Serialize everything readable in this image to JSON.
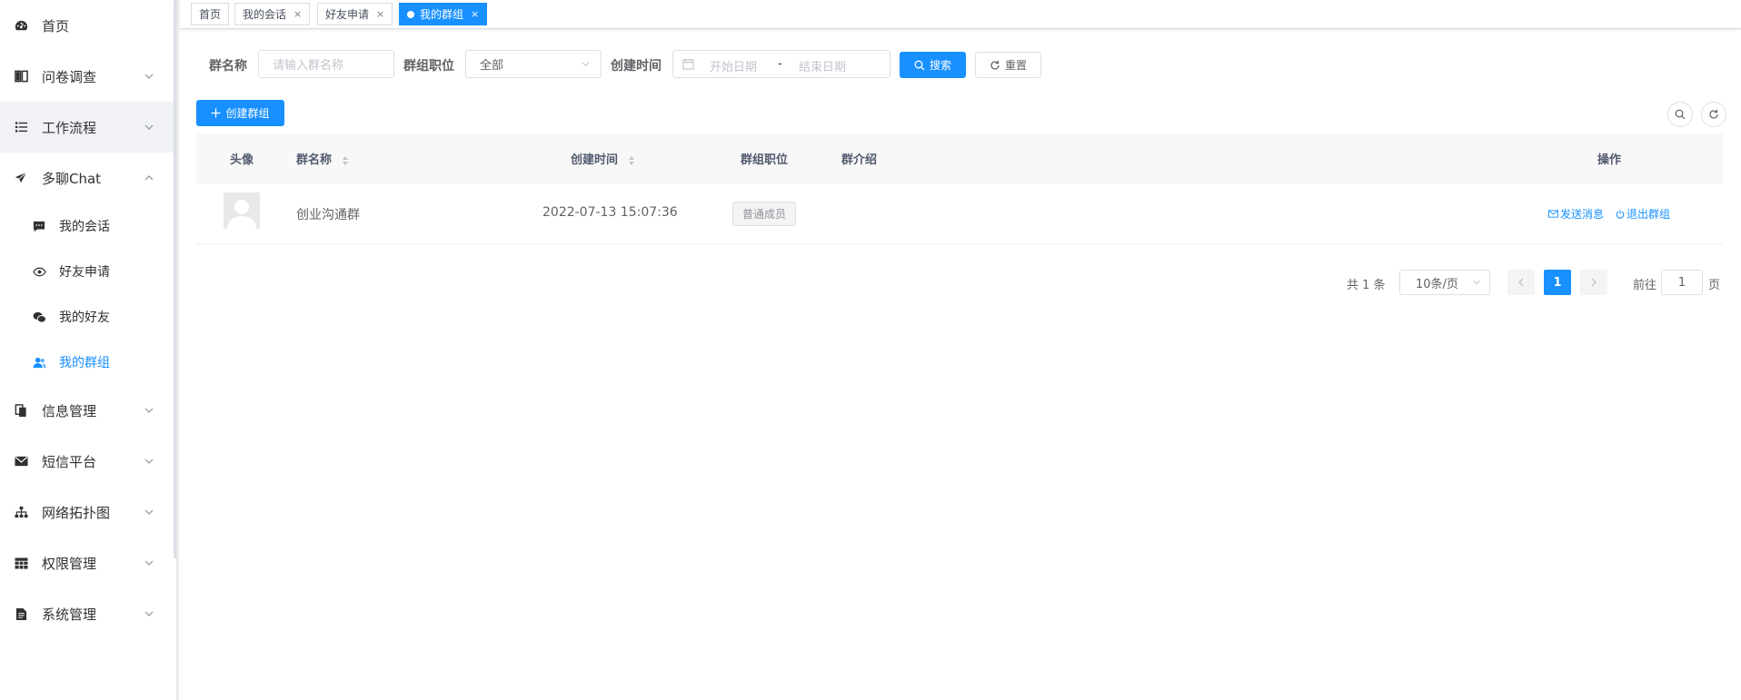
{
  "sidebar": {
    "items": [
      {
        "label": "首页",
        "icon": "dashboard-icon"
      },
      {
        "label": "问卷调查",
        "icon": "book-icon"
      },
      {
        "label": "工作流程",
        "icon": "list-icon"
      },
      {
        "label": "多聊Chat",
        "icon": "send-icon"
      },
      {
        "label": "信息管理",
        "icon": "documents-icon"
      },
      {
        "label": "短信平台",
        "icon": "mail-icon"
      },
      {
        "label": "网络拓扑图",
        "icon": "sitemap-icon"
      },
      {
        "label": "权限管理",
        "icon": "table-icon"
      },
      {
        "label": "系统管理",
        "icon": "file-text-icon"
      }
    ],
    "sub_items": [
      {
        "label": "我的会话",
        "icon": "message-icon"
      },
      {
        "label": "好友申请",
        "icon": "eye-icon"
      },
      {
        "label": "我的好友",
        "icon": "wechat-icon"
      },
      {
        "label": "我的群组",
        "icon": "users-icon"
      }
    ]
  },
  "tags": [
    {
      "label": "首页"
    },
    {
      "label": "我的会话",
      "close": "×"
    },
    {
      "label": "好友申请",
      "close": "×"
    },
    {
      "label": "我的群组",
      "close": "×"
    }
  ],
  "search": {
    "name_label": "群名称",
    "name_placeholder": "请输入群名称",
    "role_label": "群组职位",
    "role_value": "全部",
    "time_label": "创建时间",
    "start_placeholder": "开始日期",
    "range_sep": "-",
    "end_placeholder": "结束日期",
    "search_btn": "搜索",
    "reset_btn": "重置"
  },
  "toolbar": {
    "create_btn": "创建群组"
  },
  "table": {
    "headers": {
      "avatar": "头像",
      "name": "群名称",
      "created": "创建时间",
      "role": "群组职位",
      "intro": "群介绍",
      "actions": "操作"
    },
    "rows": [
      {
        "name": "创业沟通群",
        "created": "2022-07-13 15:07:36",
        "role": "普通成员",
        "intro": "",
        "send_msg": "发送消息",
        "quit_group": "退出群组"
      }
    ]
  },
  "pagination": {
    "total": "共 1 条",
    "page_size": "10条/页",
    "current_page": "1",
    "goto_label": "前往",
    "goto_value": "1",
    "page_suffix": "页"
  },
  "colors": {
    "primary": "#1890ff",
    "header_bg": "#f8f8f9",
    "tag_bg": "#f4f4f5"
  }
}
